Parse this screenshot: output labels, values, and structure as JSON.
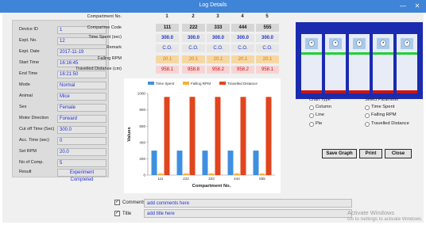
{
  "window": {
    "title": "Log Details",
    "minimize": "—",
    "close": "✕"
  },
  "info": [
    {
      "label": "Device ID",
      "value": "1"
    },
    {
      "label": "Expt. No.",
      "value": "12"
    },
    {
      "label": "Expt. Date",
      "value": "2017-11-19"
    },
    {
      "label": "Start Time",
      "value": "16:16:45"
    },
    {
      "label": "End Time",
      "value": "16:21:50"
    },
    {
      "label": "Mode",
      "value": "Normal"
    },
    {
      "label": "Animal",
      "value": "Mice"
    },
    {
      "label": "Sex",
      "value": "Female"
    },
    {
      "label": "Motor Direction",
      "value": "Forward"
    },
    {
      "label": "Cut off Time (Sec)",
      "value": "300.0"
    },
    {
      "label": "Acc. Time (sec)",
      "value": "0"
    },
    {
      "label": "Set RPM",
      "value": "20.0"
    },
    {
      "label": "No of Comp.",
      "value": "5"
    },
    {
      "label": "Result",
      "value": "Experiment Completed"
    }
  ],
  "table": {
    "row_labels": {
      "compartment_no": "Compartment No.",
      "code": "Compartme Code",
      "time_spent": "Time Spent (sec)",
      "remark": "Remark",
      "falling_rpm": "Falling RPM",
      "distance": "Travelled Distance (cm)"
    },
    "columns": [
      {
        "no": "1",
        "code": "111",
        "time": "300.0",
        "remark": "C.O.",
        "rpm": "20.1",
        "dist": "958.1"
      },
      {
        "no": "2",
        "code": "222",
        "time": "300.0",
        "remark": "C.O.",
        "rpm": "20.1",
        "dist": "958.8"
      },
      {
        "no": "3",
        "code": "333",
        "time": "300.0",
        "remark": "C.O.",
        "rpm": "20.1",
        "dist": "958.2"
      },
      {
        "no": "4",
        "code": "444",
        "time": "300.0",
        "remark": "C.O.",
        "rpm": "20.1",
        "dist": "958.2"
      },
      {
        "no": "5",
        "code": "555",
        "time": "300.0",
        "remark": "C.O.",
        "rpm": "20.1",
        "dist": "958.1"
      }
    ]
  },
  "chart_data": {
    "type": "bar",
    "categories": [
      "111",
      "222",
      "333",
      "444",
      "555"
    ],
    "series": [
      {
        "name": "Time Spent",
        "color": "#3f8fe0",
        "values": [
          300.0,
          300.0,
          300.0,
          300.0,
          300.0
        ]
      },
      {
        "name": "Falling RPM",
        "color": "#f5b23a",
        "values": [
          20.1,
          20.1,
          20.1,
          20.1,
          20.1
        ]
      },
      {
        "name": "Travelled Distance",
        "color": "#e0451d",
        "values": [
          958.1,
          958.8,
          958.2,
          958.2,
          958.1
        ]
      }
    ],
    "xlabel": "Compartment No.",
    "ylabel": "Values",
    "ylim": [
      0,
      1000
    ],
    "yticks": [
      "0",
      "200",
      "400",
      "600",
      "800",
      "1000"
    ],
    "legend": "top",
    "grid": false
  },
  "compartments": {
    "count": 5,
    "colors": {
      "frame": "#1b2bb0",
      "green_bar": "#22d033",
      "red_bar": "#c91515"
    }
  },
  "chart_type": {
    "title": "Chart Type",
    "options": [
      "Column",
      "Line",
      "Pie"
    ]
  },
  "parameter": {
    "title": "Select Parameter",
    "options": [
      "Time Spent",
      "Falling RPM",
      "Travelled Distance"
    ]
  },
  "buttons": {
    "save_graph": "Save Graph",
    "print": "Print",
    "close": "Close"
  },
  "comments": {
    "label": "Comments",
    "value": "add comments here",
    "checked": "✓"
  },
  "chart_title": {
    "label": "Title",
    "value": "add title here",
    "checked": "✓"
  },
  "watermark": {
    "line1": "Activate Windows",
    "line2": "Go to Settings to activate Windows."
  }
}
